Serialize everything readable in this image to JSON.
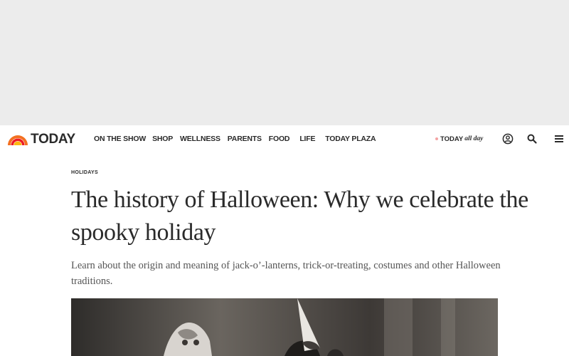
{
  "brand": {
    "name": "TODAY",
    "colors": [
      "#f37021",
      "#ed1c24",
      "#fcb711"
    ]
  },
  "nav": {
    "items": [
      {
        "label": "ON THE SHOW"
      },
      {
        "label": "SHOP"
      },
      {
        "label": "WELLNESS"
      },
      {
        "label": "PARENTS"
      },
      {
        "label": "FOOD"
      },
      {
        "label": "LIFE"
      },
      {
        "label": "TODAY PLAZA"
      }
    ]
  },
  "today_all_day": {
    "main": "TODAY",
    "script": "all day"
  },
  "icons": {
    "profile": "user-circle-icon",
    "search": "search-icon",
    "menu": "hamburger-menu-icon"
  },
  "article": {
    "category": "HOLIDAYS",
    "headline": "The history of Halloween: Why we celebrate the spooky holiday",
    "dek": "Learn about the origin and meaning of jack-o’-lanterns, trick-or-treating, costumes and other Halloween traditions."
  }
}
